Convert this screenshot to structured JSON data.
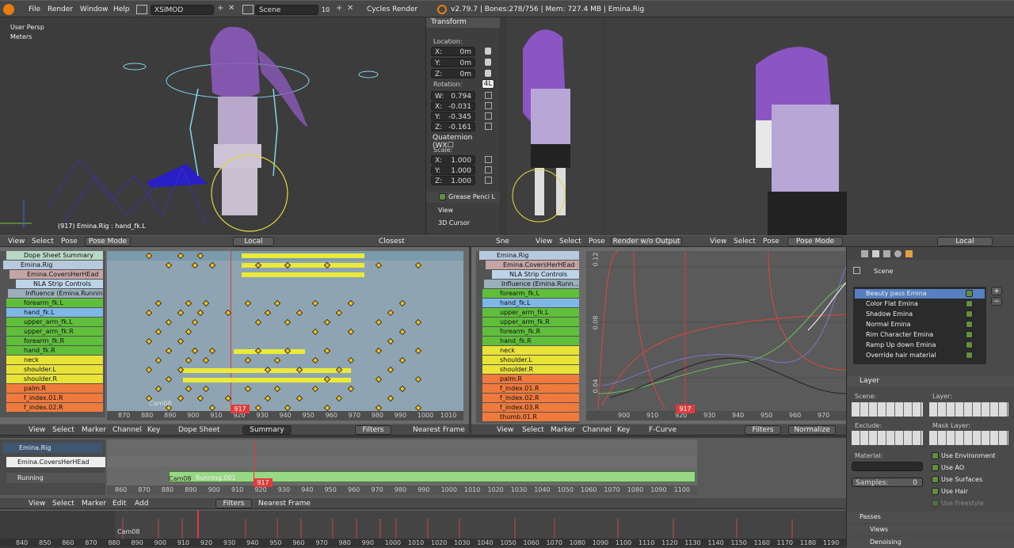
{
  "top_bar": {
    "menus": [
      "File",
      "Render",
      "Window",
      "Help"
    ],
    "layout": "XSIMOD",
    "scene": "Scene",
    "scene_users": "10",
    "engine": "Cycles Render",
    "info": "v2.79.7 | Bones:278/756 | Mem: 727.4 MB | Emina.Rig"
  },
  "viewport1": {
    "persp": "User Persp",
    "units": "Meters",
    "status": "(917) Emina.Rig : hand_fk.L"
  },
  "n_panel": {
    "title": "Transform",
    "location_label": "Location:",
    "location": [
      "X:",
      "0m",
      "Y:",
      "0m",
      "Z:",
      "0m"
    ],
    "rotation_label": "Rotation:",
    "rotation_mode_btn": "4L",
    "rotation": [
      [
        "W:",
        "0.794"
      ],
      [
        "X:",
        "-0.031"
      ],
      [
        "Y:",
        "-0.345"
      ],
      [
        "Z:",
        "-0.161"
      ]
    ],
    "rot_mode": "Quaternion (WX☐",
    "scale_label": "Scale:",
    "scale": [
      [
        "X:",
        "1.000"
      ],
      [
        "Y:",
        "1.000"
      ],
      [
        "Z:",
        "1.000"
      ]
    ],
    "grease": "Grease Penci L",
    "view": "View",
    "cursor": "3D Cursor"
  },
  "viewport_header": {
    "items": [
      "View",
      "Select",
      "Pose"
    ],
    "mode": "Pose Mode",
    "pivot": "Local",
    "snap": "Closest",
    "snap_short": "Sne"
  },
  "viewport2_header": {
    "items": [
      "View",
      "Select",
      "Pose"
    ],
    "render_btn": "Render w/o Output"
  },
  "viewport3_header": {
    "items": [
      "View",
      "Select",
      "Pose"
    ],
    "mode": "Pose Mode",
    "pivot": "Local"
  },
  "dopesheet": {
    "channels": [
      {
        "name": "Dope Sheet Summary",
        "type": "summary"
      },
      {
        "name": "Emina.Rig",
        "type": "object"
      },
      {
        "name": "Emina.CoversHerHEad",
        "type": "action"
      },
      {
        "name": "NLA Strip Controls",
        "type": "nla"
      },
      {
        "name": "Influence (Emina.Running)",
        "type": "influence"
      },
      {
        "name": "forearm_fk.L",
        "type": "green"
      },
      {
        "name": "hand_fk.L",
        "type": "blue"
      },
      {
        "name": "upper_arm_fk.L",
        "type": "green"
      },
      {
        "name": "upper_arm_fk.R",
        "type": "green"
      },
      {
        "name": "forearm_fk.R",
        "type": "green"
      },
      {
        "name": "hand_fk.R",
        "type": "green"
      },
      {
        "name": "neck",
        "type": "yellow"
      },
      {
        "name": "shoulder.L",
        "type": "yellow"
      },
      {
        "name": "shoulder.R",
        "type": "yellow"
      },
      {
        "name": "palm.R",
        "type": "orange"
      },
      {
        "name": "f_index.01.R",
        "type": "orange"
      },
      {
        "name": "f_index.02.R",
        "type": "orange"
      }
    ],
    "ruler": [
      "870",
      "880",
      "890",
      "900",
      "910",
      "920",
      "930",
      "940",
      "950",
      "960",
      "970",
      "980",
      "990",
      "1000",
      "1010"
    ],
    "current_frame": "917",
    "marker": "Cam08",
    "header": [
      "View",
      "Select",
      "Marker",
      "Channel",
      "Key"
    ],
    "mode": "Dope Sheet",
    "summary_btn": "Summary",
    "filters": "Filters",
    "snap": "Nearest Frame"
  },
  "graph": {
    "channels": [
      {
        "name": "Emina.Rig",
        "type": "object"
      },
      {
        "name": "Emina.CoversHerHEad",
        "type": "action"
      },
      {
        "name": "NLA Strip Controls",
        "type": "nla"
      },
      {
        "name": "Influence (Emina.Runn...",
        "type": "influence"
      },
      {
        "name": "forearm_fk.L",
        "type": "green"
      },
      {
        "name": "hand_fk.L",
        "type": "blue"
      },
      {
        "name": "upper_arm_fk.L",
        "type": "green"
      },
      {
        "name": "upper_arm_fk.R",
        "type": "green"
      },
      {
        "name": "forearm_fk.R",
        "type": "green"
      },
      {
        "name": "hand_fk.R",
        "type": "green"
      },
      {
        "name": "neck",
        "type": "yellow"
      },
      {
        "name": "shoulder.L",
        "type": "yellow"
      },
      {
        "name": "shoulder.R",
        "type": "yellow"
      },
      {
        "name": "palm.R",
        "type": "orange"
      },
      {
        "name": "f_index.01.R",
        "type": "orange"
      },
      {
        "name": "f_index.02.R",
        "type": "orange"
      },
      {
        "name": "f_index.03.R",
        "type": "orange"
      },
      {
        "name": "thumb.01.R",
        "type": "orange"
      }
    ],
    "y_labels": [
      "0.12",
      "0.08",
      "0.04"
    ],
    "ruler": [
      "900",
      "910",
      "920",
      "930",
      "940",
      "950",
      "960",
      "970"
    ],
    "current_frame": "917",
    "header": [
      "View",
      "Select",
      "Marker",
      "Channel",
      "Key"
    ],
    "mode": "F-Curve",
    "filters": "Filters",
    "pivot": "Normalize"
  },
  "properties": {
    "scene_label": "Scene",
    "render_layers": [
      "Beauty pass Emina",
      "Color Flat Emina",
      "Shadow Emina",
      "Normal Emina",
      "Rim Character Emina",
      "Ramp Up down Emina",
      "Override hair material"
    ],
    "layer_panel": "Layer",
    "scene_sub": "Scene:",
    "layer_sub": "Layer:",
    "exclude": "Exclude:",
    "mask_layer": "Mask Layer:",
    "material": "Material:",
    "samples": "Samples:",
    "samples_val": "0",
    "use_opts": [
      "Use Environment",
      "Use AO",
      "Use Surfaces",
      "Use Hair",
      "Use Freestyle"
    ],
    "collapsed": [
      "Passes",
      "Views",
      "Denoising"
    ]
  },
  "nla": {
    "tracks": [
      {
        "name": "Emina.Rig"
      },
      {
        "name": "Emina.CoversHerHEad"
      },
      {
        "name": "Running"
      }
    ],
    "strip_marker": "Cam08",
    "strip_name": "Running.001",
    "ruler": [
      "860",
      "870",
      "880",
      "890",
      "900",
      "910",
      "920",
      "930",
      "940",
      "950",
      "960",
      "970",
      "980",
      "990",
      "1000",
      "1010",
      "1020",
      "1030",
      "1040",
      "1050",
      "1060",
      "1070",
      "1080",
      "1090",
      "1100"
    ],
    "current_frame": "917",
    "header": [
      "View",
      "Select",
      "Marker",
      "Edit",
      "Add"
    ],
    "filters": "Filters",
    "snap": "Nearest Frame"
  },
  "timeline": {
    "marker": "Cam08",
    "ruler": [
      "840",
      "850",
      "860",
      "870",
      "880",
      "890",
      "900",
      "910",
      "920",
      "930",
      "940",
      "950",
      "960",
      "970",
      "980",
      "990",
      "1000",
      "1010",
      "1020",
      "1030",
      "1040",
      "1050",
      "1060",
      "1070",
      "1080",
      "1090",
      "1100",
      "1110",
      "1120",
      "1130",
      "1140",
      "1150",
      "1160",
      "1170",
      "1180",
      "1190"
    ]
  },
  "colors": {
    "green": "#5fbf3a",
    "blue": "#7fb7e6",
    "yellow": "#e9e337",
    "orange": "#ef7a3c",
    "keyframe": "#f3c31d",
    "playhead": "#e23b3b",
    "nla_strip": "#98d884"
  }
}
